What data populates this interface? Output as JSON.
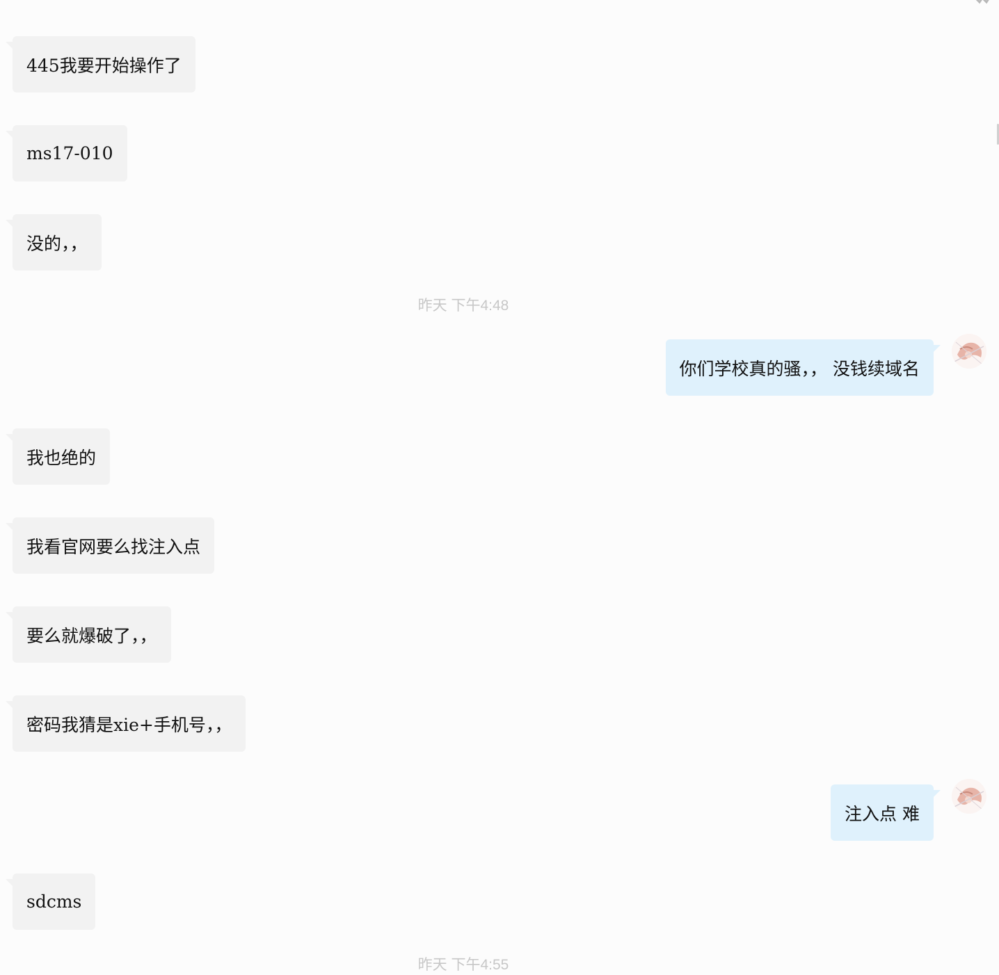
{
  "messages": [
    {
      "text": "445我要开始操作了",
      "direction": "incoming"
    },
    {
      "text": "ms17-010",
      "direction": "incoming"
    },
    {
      "text": "没的，，",
      "direction": "incoming"
    },
    {
      "text": "你们学校真的骚，， 没钱续域名",
      "direction": "outgoing"
    },
    {
      "text": "我也绝的",
      "direction": "incoming"
    },
    {
      "text": "我看官网要么找注入点",
      "direction": "incoming"
    },
    {
      "text": "要么就爆破了，，",
      "direction": "incoming"
    },
    {
      "text": "密码我猜是xie+手机号，，",
      "direction": "incoming"
    },
    {
      "text": "注入点 难",
      "direction": "outgoing"
    },
    {
      "text": "sdcms",
      "direction": "incoming"
    }
  ],
  "timestamps": [
    "昨天  下午4:48",
    "昨天  下午4:55"
  ],
  "avatar": {
    "icon": "user-avatar-icon"
  },
  "colors": {
    "incoming_bubble": "#f2f2f2",
    "outgoing_bubble": "#dff1fc",
    "background": "#fcfcfc",
    "timestamp": "#c7c7c7"
  }
}
